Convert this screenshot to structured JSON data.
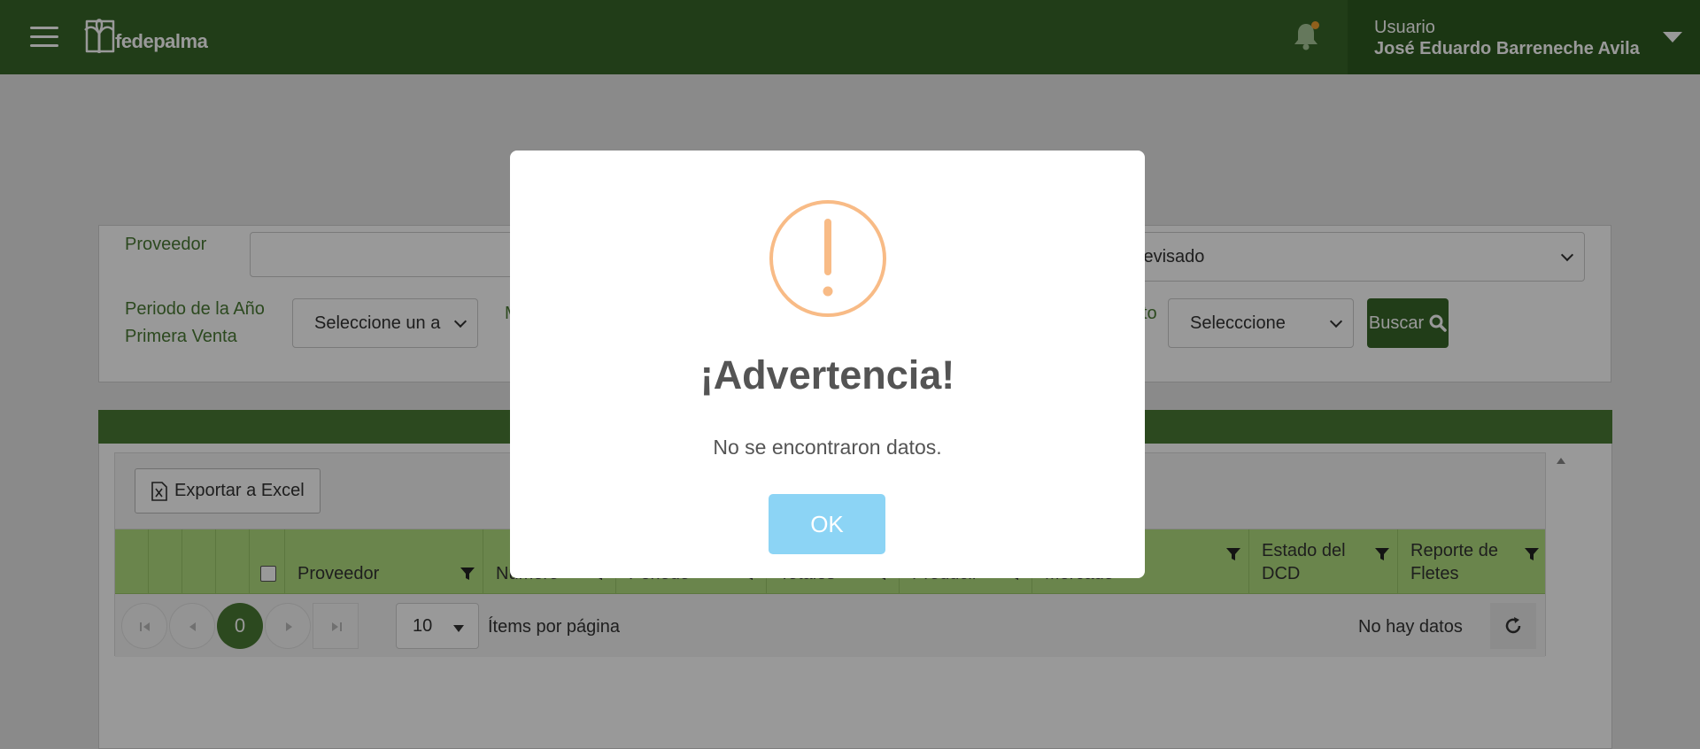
{
  "header": {
    "brand": "fedepalma",
    "user_label": "Usuario",
    "user_name": "José Eduardo Barreneche Avila"
  },
  "filters": {
    "proveedor_label": "Proveedor",
    "proveedor_value": "",
    "estado_value": "Revisado",
    "periodo_label_line1": "Periodo de la Año",
    "periodo_label_line2": "Primera Venta",
    "periodo_value": "Seleccione un a",
    "hidden_label_fragment": "M",
    "right_label_fragment": "to",
    "select_value": "Selecccione",
    "buscar_label": "Buscar"
  },
  "grid": {
    "export_label": "Exportar a Excel",
    "columns": [
      {
        "label": ""
      },
      {
        "label": ""
      },
      {
        "label": ""
      },
      {
        "label": ""
      },
      {
        "label": "Proveedor"
      },
      {
        "label": "Número"
      },
      {
        "label": "Periodo"
      },
      {
        "label": "Totales"
      },
      {
        "label": "Producir"
      },
      {
        "label": "Mercado"
      },
      {
        "label": "Estado del DCD"
      },
      {
        "label": "Reporte de Fletes"
      }
    ],
    "column_lines": {
      "estado_line1": "Estado del",
      "estado_line2": "DCD",
      "reporte_line1": "Reporte de",
      "reporte_line2": "Fletes"
    },
    "pager": {
      "current_page": "0",
      "page_size": "10",
      "items_per_page_label": "Ítems por página",
      "status_text": "No hay datos"
    }
  },
  "modal": {
    "title": "¡Advertencia!",
    "message": "No se encontraron datos.",
    "ok_label": "OK"
  },
  "colors": {
    "header_green": "#386628",
    "table_header_green": "#b1de7f",
    "warning_orange": "#f8bb86",
    "ok_button": "#8cd4f5"
  }
}
